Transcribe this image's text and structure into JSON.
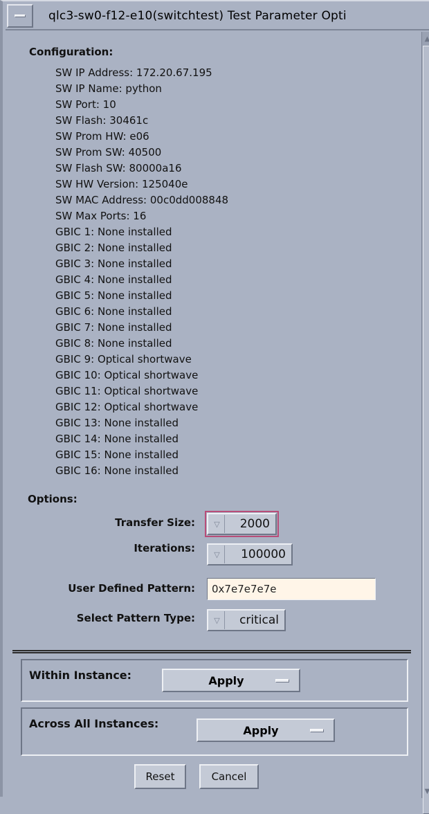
{
  "window": {
    "title": "qlc3-sw0-f12-e10(switchtest) Test Parameter Opti"
  },
  "configuration": {
    "heading": "Configuration:",
    "lines": [
      "SW IP Address: 172.20.67.195",
      "SW IP Name: python",
      "SW Port: 10",
      "SW Flash: 30461c",
      "SW Prom HW: e06",
      "SW Prom SW: 40500",
      "SW Flash SW: 80000a16",
      "SW HW Version: 125040e",
      "SW MAC Address: 00c0dd008848",
      "SW Max Ports: 16",
      "GBIC 1: None installed",
      "GBIC 2: None installed",
      "GBIC 3: None installed",
      "GBIC 4: None installed",
      "GBIC 5: None installed",
      "GBIC 6: None installed",
      "GBIC 7: None installed",
      "GBIC 8: None installed",
      "GBIC 9: Optical shortwave",
      "GBIC 10: Optical shortwave",
      "GBIC 11: Optical shortwave",
      "GBIC 12: Optical shortwave",
      "GBIC 13: None installed",
      "GBIC 14: None installed",
      "GBIC 15: None installed",
      "GBIC 16: None installed"
    ]
  },
  "options": {
    "heading": "Options:",
    "transfer_size": {
      "label": "Transfer Size:",
      "value": "2000"
    },
    "iterations": {
      "label": "Iterations:",
      "value": "100000"
    },
    "user_pattern": {
      "label": "User Defined Pattern:",
      "value": "0x7e7e7e7e"
    },
    "pattern_type": {
      "label": "Select Pattern Type:",
      "value": "critical"
    }
  },
  "apply": {
    "within": {
      "label": "Within Instance:",
      "button": "Apply"
    },
    "across": {
      "label": "Across All Instances:",
      "button": "Apply"
    }
  },
  "buttons": {
    "reset": "Reset",
    "cancel": "Cancel"
  },
  "colors": {
    "background": "#aab2c3",
    "focus": "#b84d78",
    "field_bg": "#fff5e8"
  },
  "icons": {
    "window_menu": "window-menu-icon",
    "dropdown": "dropdown-arrow-icon"
  }
}
